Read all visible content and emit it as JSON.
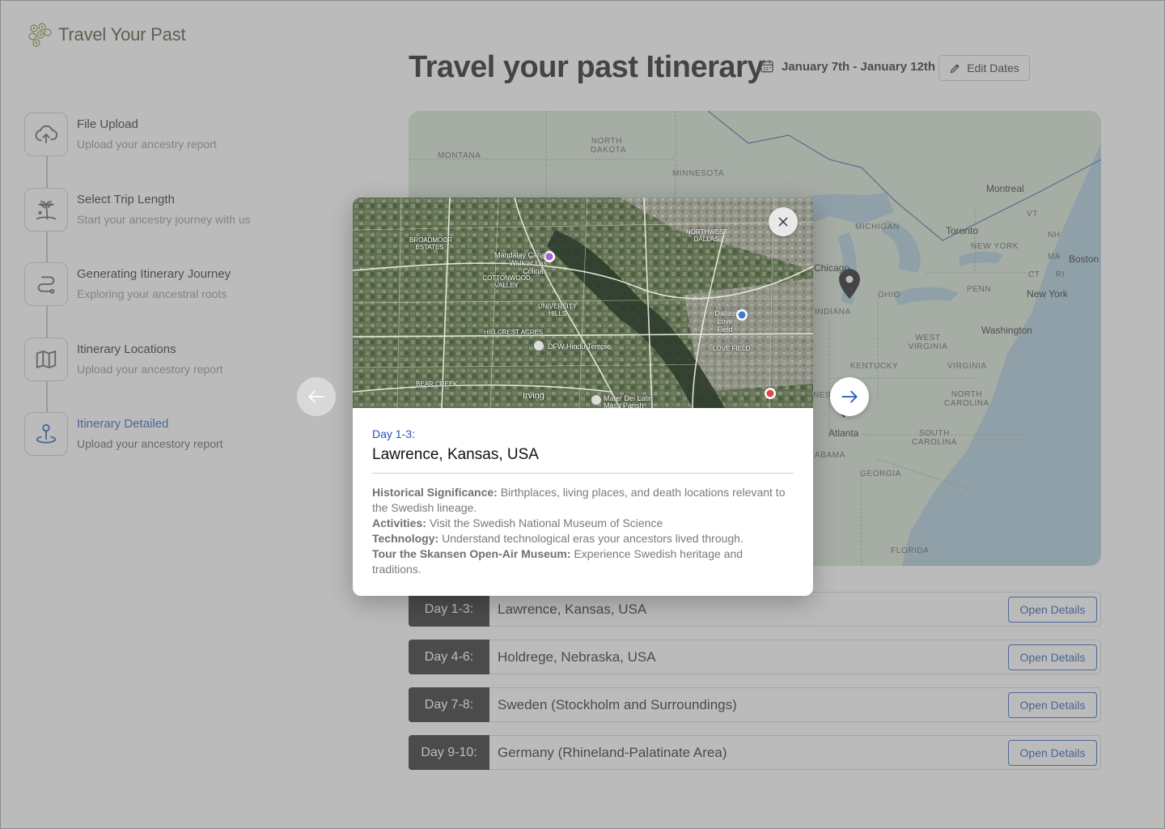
{
  "app": {
    "name": "Travel Your Past"
  },
  "steps": [
    {
      "title": "File Upload",
      "subtitle": "Upload your ancestry report",
      "icon": "cloud-upload-icon"
    },
    {
      "title": "Select Trip Length",
      "subtitle": "Start your ancestry journey with us",
      "icon": "palm-tree-icon"
    },
    {
      "title": "Generating Itinerary Journey",
      "subtitle": "Exploring your ancestral roots",
      "icon": "route-icon"
    },
    {
      "title": "Itinerary Locations",
      "subtitle": "Upload your ancestory report",
      "icon": "map-icon"
    },
    {
      "title": "Itinerary Detailed",
      "subtitle": "Upload your ancestory report",
      "icon": "map-pin-icon",
      "active": true
    }
  ],
  "header": {
    "title": "Travel your past Itinerary",
    "dates": "January 7th - January 12th",
    "edit_label": "Edit Dates"
  },
  "map": {
    "regions": [
      "MONTANA",
      "NORTH DAKOTA",
      "MINNESOTA",
      "MICHIGAN",
      "OHIO",
      "INDIANA",
      "WEST VIRGINIA",
      "VIRGINIA",
      "KENTUCKY",
      "NORTH CAROLINA",
      "SOUTH CAROLINA",
      "GEORGIA",
      "FLORIDA",
      "PENN",
      "NEW YORK",
      "VT",
      "NH",
      "MA",
      "CT",
      "RI",
      "ABAMA",
      "NESSEE"
    ],
    "cities": [
      "Chicago",
      "Montreal",
      "Toronto",
      "Boston",
      "New York",
      "Washington",
      "Atlanta"
    ]
  },
  "itinerary": [
    {
      "day": "Day 1-3:",
      "place": "Lawrence, Kansas, USA",
      "button": "Open Details"
    },
    {
      "day": "Day 4-6:",
      "place": "Holdrege, Nebraska, USA",
      "button": "Open Details"
    },
    {
      "day": "Day 7-8:",
      "place": "Sweden (Stockholm and Surroundings)",
      "button": "Open Details"
    },
    {
      "day": "Day 9-10:",
      "place": "Germany (Rhineland-Palatinate Area)",
      "button": "Open Details"
    }
  ],
  "modal": {
    "day": "Day 1-3:",
    "place": "Lawrence, Kansas, USA",
    "details": [
      {
        "label": "Historical Significance:",
        "text": "Birthplaces, living places, and death locations relevant to the Swedish lineage."
      },
      {
        "label": "Activities:",
        "text": "Visit the Swedish National Museum of Science"
      },
      {
        "label": "Technology:",
        "text": "Understand technological eras your ancestors lived through."
      },
      {
        "label": "Tour the Skansen Open-Air Museum:",
        "text": "Experience Swedish heritage and traditions."
      }
    ],
    "map_labels": [
      "Mandalay Canal Walk at Las Colinas",
      "COTTONWOOD VALLEY",
      "UNIVERSITY HILLS",
      "HILLCREST ACRES",
      "DFW Hindu Temple",
      "Irving",
      "BEAR CREEK",
      "Dallas Love Field",
      "NORTHWEST DALLAS",
      "LOVE FIELD",
      "Mater Dei Latin Mass Parish",
      "BROADMOOR ESTATES"
    ]
  },
  "colors": {
    "accent": "#1f55b8",
    "day_badge": "#1f1f1f",
    "map_water": "#a9c8d8"
  }
}
